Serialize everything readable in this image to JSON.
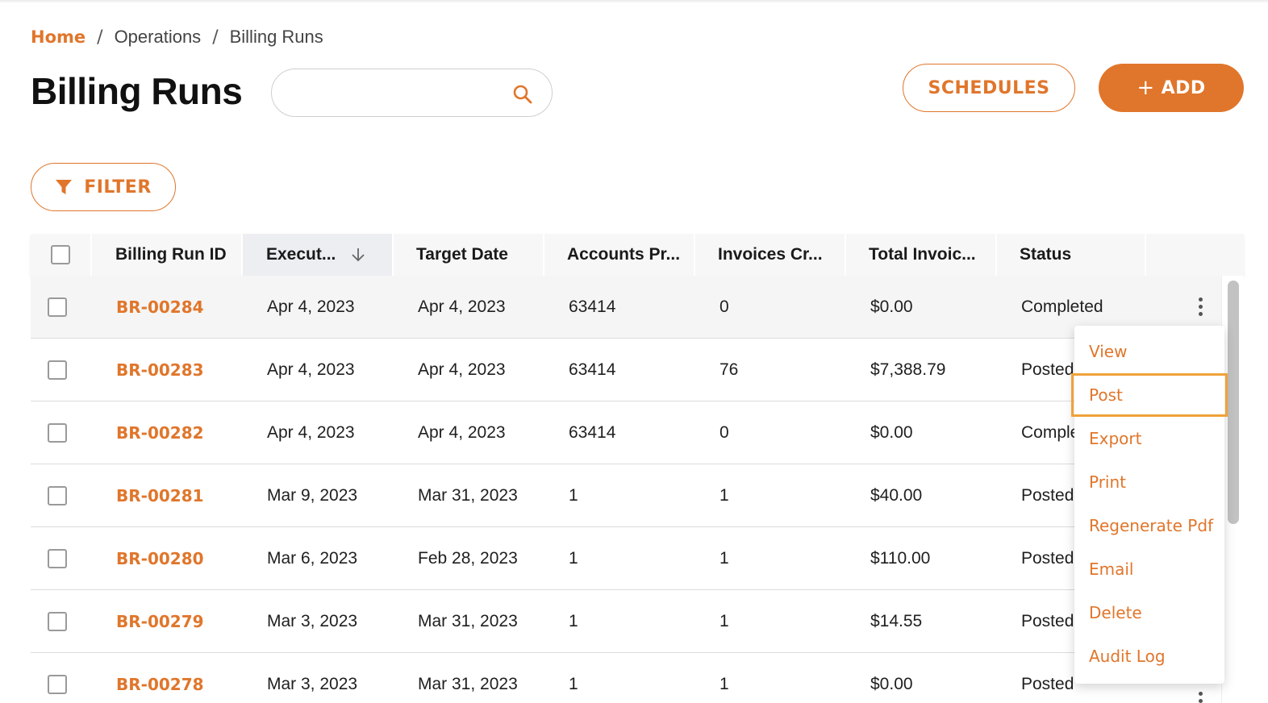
{
  "breadcrumb": {
    "home": "Home",
    "separator": "/",
    "section": "Operations",
    "current": "Billing Runs"
  },
  "page": {
    "title": "Billing Runs"
  },
  "search": {
    "value": "",
    "icon": "search-icon"
  },
  "actions": {
    "schedules_label": "SCHEDULES",
    "add_plus": "+",
    "add_label": "ADD",
    "filter_label": "FILTER"
  },
  "colors": {
    "accent": "#e0762b",
    "focus_outline": "#f0a23a"
  },
  "table": {
    "columns": [
      {
        "label": "Billing Run ID"
      },
      {
        "label": "Execut...",
        "sort": "descending"
      },
      {
        "label": "Target Date"
      },
      {
        "label": "Accounts Pr..."
      },
      {
        "label": "Invoices Cr..."
      },
      {
        "label": "Total Invoic..."
      },
      {
        "label": "Status"
      }
    ],
    "rows": [
      {
        "id": "BR-00284",
        "executed": "Apr 4, 2023",
        "target": "Apr 4, 2023",
        "accounts": "63414",
        "invoices": "0",
        "total": "$0.00",
        "status": "Completed"
      },
      {
        "id": "BR-00283",
        "executed": "Apr 4, 2023",
        "target": "Apr 4, 2023",
        "accounts": "63414",
        "invoices": "76",
        "total": "$7,388.79",
        "status": "Posted"
      },
      {
        "id": "BR-00282",
        "executed": "Apr 4, 2023",
        "target": "Apr 4, 2023",
        "accounts": "63414",
        "invoices": "0",
        "total": "$0.00",
        "status": "Comple"
      },
      {
        "id": "BR-00281",
        "executed": "Mar 9, 2023",
        "target": "Mar 31, 2023",
        "accounts": "1",
        "invoices": "1",
        "total": "$40.00",
        "status": "Posted"
      },
      {
        "id": "BR-00280",
        "executed": "Mar 6, 2023",
        "target": "Feb 28, 2023",
        "accounts": "1",
        "invoices": "1",
        "total": "$110.00",
        "status": "Posted"
      },
      {
        "id": "BR-00279",
        "executed": "Mar 3, 2023",
        "target": "Mar 31, 2023",
        "accounts": "1",
        "invoices": "1",
        "total": "$14.55",
        "status": "Posted"
      },
      {
        "id": "BR-00278",
        "executed": "Mar 3, 2023",
        "target": "Mar 31, 2023",
        "accounts": "1",
        "invoices": "1",
        "total": "$0.00",
        "status": "Posted"
      }
    ]
  },
  "row_menu": {
    "items": [
      "View",
      "Post",
      "Export",
      "Print",
      "Regenerate Pdf",
      "Email",
      "Delete",
      "Audit Log"
    ],
    "focused": "Post"
  }
}
